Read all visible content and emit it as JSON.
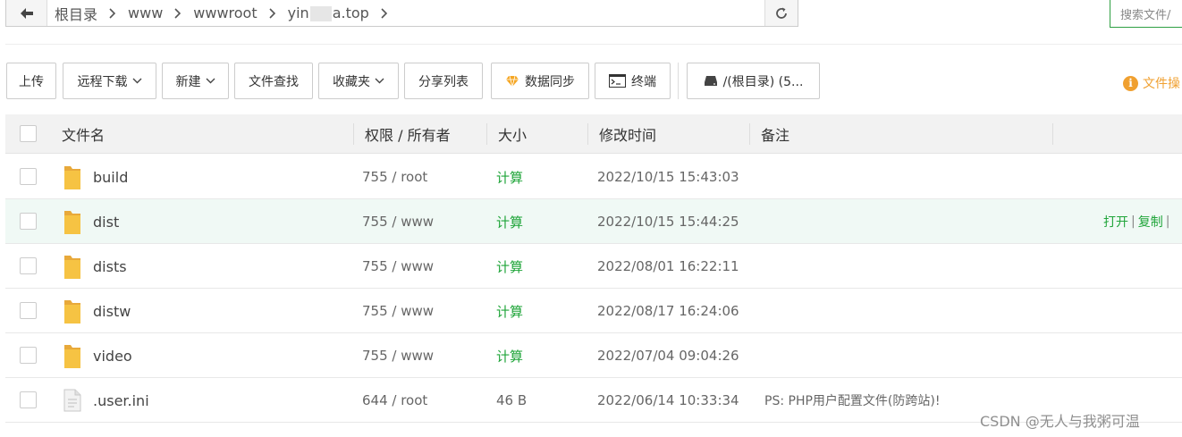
{
  "path": {
    "crumbs": [
      "根目录",
      "www",
      "wwwroot",
      "yin",
      "a.top"
    ]
  },
  "search": {
    "placeholder": "搜索文件/"
  },
  "toolbar": {
    "upload": "上传",
    "remote_download": "远程下载",
    "new": "新建",
    "file_search": "文件查找",
    "favorites": "收藏夹",
    "share_list": "分享列表",
    "data_sync": "数据同步",
    "terminal": "终端",
    "disk": "/(根目录) (5...",
    "help": "文件操"
  },
  "table": {
    "headers": {
      "name": "文件名",
      "perm": "权限 / 所有者",
      "size": "大小",
      "mtime": "修改时间",
      "note": "备注"
    },
    "rows": [
      {
        "name": "build",
        "type": "folder",
        "perm": "755 / root",
        "size": "计算",
        "mtime": "2022/10/15 15:43:03",
        "note": ""
      },
      {
        "name": "dist",
        "type": "folder",
        "perm": "755 / www",
        "size": "计算",
        "mtime": "2022/10/15 15:44:25",
        "note": ""
      },
      {
        "name": "dists",
        "type": "folder",
        "perm": "755 / www",
        "size": "计算",
        "mtime": "2022/08/01 16:22:11",
        "note": ""
      },
      {
        "name": "distw",
        "type": "folder",
        "perm": "755 / www",
        "size": "计算",
        "mtime": "2022/08/17 16:24:06",
        "note": ""
      },
      {
        "name": "video",
        "type": "folder",
        "perm": "755 / www",
        "size": "计算",
        "mtime": "2022/07/04 09:04:26",
        "note": ""
      },
      {
        "name": ".user.ini",
        "type": "file",
        "perm": "644 / root",
        "size": "46 B",
        "mtime": "2022/06/14 10:33:34",
        "note": "PS: PHP用户配置文件(防跨站)!"
      }
    ],
    "row_actions": {
      "open": "打开",
      "copy": "复制",
      "sep": "|"
    }
  },
  "colors": {
    "accent": "#20a53a",
    "warning": "#f0a030",
    "folder": "#f6c343"
  },
  "watermark": "CSDN @无人与我粥可温"
}
